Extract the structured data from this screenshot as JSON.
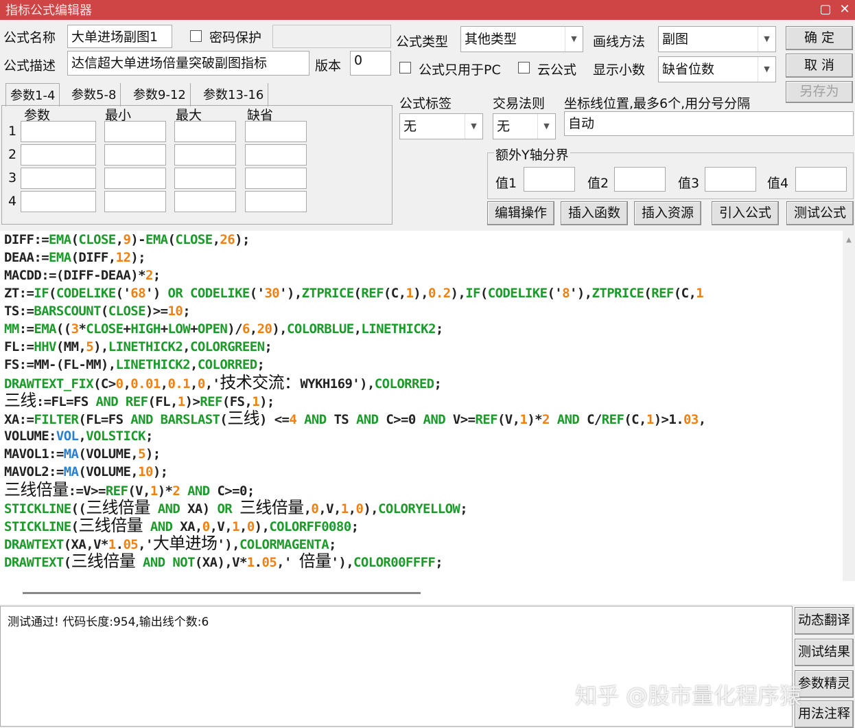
{
  "window": {
    "title": "指标公式编辑器",
    "minimize": "▢",
    "close": "✕"
  },
  "form": {
    "name_label": "公式名称",
    "name_value": "大单进场副图1",
    "password_label": "密码保护",
    "desc_label": "公式描述",
    "desc_value": "达信超大单进场倍量突破副图指标",
    "version_label": "版本",
    "version_value": "0",
    "type_label": "公式类型",
    "type_value": "其他类型",
    "draw_label": "画线方法",
    "draw_value": "副图",
    "pc_only_label": "公式只用于PC",
    "cloud_label": "云公式",
    "decimals_label": "显示小数",
    "decimals_value": "缺省位数",
    "tag_label": "公式标签",
    "tag_value": "无",
    "rule_label": "交易法则",
    "rule_value": "无",
    "axis_label": "坐标线位置,最多6个,用分号分隔",
    "axis_value": "自动",
    "extra_y_label": "额外Y轴分界",
    "v1": "值1",
    "v2": "值2",
    "v3": "值3",
    "v4": "值4"
  },
  "buttons": {
    "ok": "确 定",
    "cancel": "取 消",
    "save_as": "另存为",
    "edit": "编辑操作",
    "insert_func": "插入函数",
    "insert_res": "插入资源",
    "import": "引入公式",
    "test": "测试公式",
    "translate": "动态翻译",
    "result": "测试结果",
    "wizard": "参数精灵",
    "usage": "用法注释"
  },
  "params": {
    "tabs": [
      "参数1-4",
      "参数5-8",
      "参数9-12",
      "参数13-16"
    ],
    "headers": [
      "参数",
      "最小",
      "最大",
      "缺省"
    ],
    "rows": [
      "1",
      "2",
      "3",
      "4"
    ]
  },
  "code": [
    [
      [
        "DIFF:=",
        "k"
      ],
      [
        "EMA",
        "g"
      ],
      [
        "(",
        "k"
      ],
      [
        "CLOSE",
        "g"
      ],
      [
        ",",
        "k"
      ],
      [
        "9",
        "o"
      ],
      [
        ")-",
        "k"
      ],
      [
        "EMA",
        "g"
      ],
      [
        "(",
        "k"
      ],
      [
        "CLOSE",
        "g"
      ],
      [
        ",",
        "k"
      ],
      [
        "26",
        "o"
      ],
      [
        ");",
        "k"
      ]
    ],
    [
      [
        "DEAA:=",
        "k"
      ],
      [
        "EMA",
        "g"
      ],
      [
        "(DIFF,",
        "k"
      ],
      [
        "12",
        "o"
      ],
      [
        ");",
        "k"
      ]
    ],
    [
      [
        "MACDD:=(DIFF-DEAA)*",
        "k"
      ],
      [
        "2",
        "o"
      ],
      [
        ";",
        "k"
      ]
    ],
    [
      [
        "ZT:=",
        "k"
      ],
      [
        "IF",
        "g"
      ],
      [
        "(",
        "k"
      ],
      [
        "CODELIKE",
        "g"
      ],
      [
        "('",
        "k"
      ],
      [
        "68",
        "o"
      ],
      [
        "') ",
        "k"
      ],
      [
        "OR",
        "g"
      ],
      [
        " ",
        "k"
      ],
      [
        "CODELIKE",
        "g"
      ],
      [
        "('",
        "k"
      ],
      [
        "30",
        "o"
      ],
      [
        "'),",
        "k"
      ],
      [
        "ZTPRICE",
        "g"
      ],
      [
        "(",
        "k"
      ],
      [
        "REF",
        "g"
      ],
      [
        "(C,",
        "k"
      ],
      [
        "1",
        "o"
      ],
      [
        "),",
        "k"
      ],
      [
        "0.2",
        "o"
      ],
      [
        "),",
        "k"
      ],
      [
        "IF",
        "g"
      ],
      [
        "(",
        "k"
      ],
      [
        "CODELIKE",
        "g"
      ],
      [
        "('",
        "k"
      ],
      [
        "8",
        "o"
      ],
      [
        "'),",
        "k"
      ],
      [
        "ZTPRICE",
        "g"
      ],
      [
        "(",
        "k"
      ],
      [
        "REF",
        "g"
      ],
      [
        "(C,",
        "k"
      ],
      [
        "1",
        "o"
      ]
    ],
    [
      [
        "TS:=",
        "k"
      ],
      [
        "BARSCOUNT",
        "g"
      ],
      [
        "(",
        "k"
      ],
      [
        "CLOSE",
        "g"
      ],
      [
        ")>=",
        "k"
      ],
      [
        "10",
        "o"
      ],
      [
        ";",
        "k"
      ]
    ],
    [
      [
        "MM",
        "g"
      ],
      [
        ":=",
        "k"
      ],
      [
        "EMA",
        "g"
      ],
      [
        "((",
        "k"
      ],
      [
        "3",
        "o"
      ],
      [
        "*",
        "k"
      ],
      [
        "CLOSE",
        "g"
      ],
      [
        "+",
        "k"
      ],
      [
        "HIGH",
        "g"
      ],
      [
        "+",
        "k"
      ],
      [
        "LOW",
        "g"
      ],
      [
        "+",
        "k"
      ],
      [
        "OPEN",
        "g"
      ],
      [
        ")/",
        "k"
      ],
      [
        "6",
        "o"
      ],
      [
        ",",
        "k"
      ],
      [
        "20",
        "o"
      ],
      [
        "),",
        "k"
      ],
      [
        "COLORBLUE",
        "g"
      ],
      [
        ",",
        "k"
      ],
      [
        "LINETHICK2",
        "g"
      ],
      [
        ";",
        "k"
      ]
    ],
    [
      [
        "FL:=",
        "k"
      ],
      [
        "HHV",
        "g"
      ],
      [
        "(MM,",
        "k"
      ],
      [
        "5",
        "o"
      ],
      [
        "),",
        "k"
      ],
      [
        "LINETHICK2",
        "g"
      ],
      [
        ",",
        "k"
      ],
      [
        "COLORGREEN",
        "g"
      ],
      [
        ";",
        "k"
      ]
    ],
    [
      [
        "FS:=MM-(FL-MM),",
        "k"
      ],
      [
        "LINETHICK2",
        "g"
      ],
      [
        ",",
        "k"
      ],
      [
        "COLORRED",
        "g"
      ],
      [
        ";",
        "k"
      ]
    ],
    [
      [
        "DRAWTEXT_FIX",
        "g"
      ],
      [
        "(C>",
        "k"
      ],
      [
        "0",
        "o"
      ],
      [
        ",",
        "k"
      ],
      [
        "0.01",
        "o"
      ],
      [
        ",",
        "k"
      ],
      [
        "0.1",
        "o"
      ],
      [
        ",",
        "k"
      ],
      [
        "0",
        "o"
      ],
      [
        ",'",
        "k"
      ],
      [
        "技术交流：",
        "cn"
      ],
      [
        "WYKH169'),",
        "k"
      ],
      [
        "COLORRED",
        "g"
      ],
      [
        ";",
        "k"
      ]
    ],
    [
      [
        "三线",
        "cn"
      ],
      [
        ":=FL=FS ",
        "k"
      ],
      [
        "AND",
        "g"
      ],
      [
        " ",
        "k"
      ],
      [
        "REF",
        "g"
      ],
      [
        "(FL,",
        "k"
      ],
      [
        "1",
        "o"
      ],
      [
        ")>",
        "k"
      ],
      [
        "REF",
        "g"
      ],
      [
        "(FS,",
        "k"
      ],
      [
        "1",
        "o"
      ],
      [
        ");",
        "k"
      ]
    ],
    [
      [
        "XA:=",
        "k"
      ],
      [
        "FILTER",
        "g"
      ],
      [
        "(FL=FS ",
        "k"
      ],
      [
        "AND",
        "g"
      ],
      [
        " ",
        "k"
      ],
      [
        "BARSLAST",
        "g"
      ],
      [
        "(",
        "k"
      ],
      [
        "三线",
        "cn"
      ],
      [
        ") <=",
        "k"
      ],
      [
        "4",
        "o"
      ],
      [
        " ",
        "k"
      ],
      [
        "AND",
        "g"
      ],
      [
        " TS ",
        "k"
      ],
      [
        "AND",
        "g"
      ],
      [
        " C>=0 ",
        "k"
      ],
      [
        "AND",
        "g"
      ],
      [
        " V>=",
        "k"
      ],
      [
        "REF",
        "g"
      ],
      [
        "(V,",
        "k"
      ],
      [
        "1",
        "o"
      ],
      [
        ")*",
        "k"
      ],
      [
        "2",
        "o"
      ],
      [
        " ",
        "k"
      ],
      [
        "AND",
        "g"
      ],
      [
        " C/",
        "k"
      ],
      [
        "REF",
        "g"
      ],
      [
        "(C,",
        "k"
      ],
      [
        "1",
        "o"
      ],
      [
        ")>1.",
        "k"
      ],
      [
        "03",
        "o"
      ],
      [
        ",",
        "k"
      ]
    ],
    [
      [
        "VOLUME:",
        "k"
      ],
      [
        "VOL",
        "b"
      ],
      [
        ",",
        "k"
      ],
      [
        "VOLSTICK",
        "g"
      ],
      [
        ";",
        "k"
      ]
    ],
    [
      [
        "MAVOL1:=",
        "k"
      ],
      [
        "MA",
        "b"
      ],
      [
        "(VOLUME,",
        "k"
      ],
      [
        "5",
        "o"
      ],
      [
        ");",
        "k"
      ]
    ],
    [
      [
        "MAVOL2:=",
        "k"
      ],
      [
        "MA",
        "b"
      ],
      [
        "(VOLUME,",
        "k"
      ],
      [
        "10",
        "o"
      ],
      [
        ");",
        "k"
      ]
    ],
    [
      [
        "三线倍量",
        "cn"
      ],
      [
        ":=V>=",
        "k"
      ],
      [
        "REF",
        "g"
      ],
      [
        "(V,",
        "k"
      ],
      [
        "1",
        "o"
      ],
      [
        ")*",
        "k"
      ],
      [
        "2",
        "o"
      ],
      [
        " ",
        "k"
      ],
      [
        "AND",
        "g"
      ],
      [
        " C>=0;",
        "k"
      ]
    ],
    [
      [
        "STICKLINE",
        "g"
      ],
      [
        "((",
        "k"
      ],
      [
        "三线倍量",
        "cn"
      ],
      [
        " ",
        "k"
      ],
      [
        "AND",
        "g"
      ],
      [
        " XA) ",
        "k"
      ],
      [
        "OR",
        "g"
      ],
      [
        " ",
        "k"
      ],
      [
        "三线倍量",
        "cn"
      ],
      [
        ",",
        "k"
      ],
      [
        "0",
        "o"
      ],
      [
        ",V,",
        "k"
      ],
      [
        "1",
        "o"
      ],
      [
        ",",
        "k"
      ],
      [
        "0",
        "o"
      ],
      [
        "),",
        "k"
      ],
      [
        "COLORYELLOW",
        "g"
      ],
      [
        ";",
        "k"
      ]
    ],
    [
      [
        "STICKLINE",
        "g"
      ],
      [
        "(",
        "k"
      ],
      [
        "三线倍量",
        "cn"
      ],
      [
        " ",
        "k"
      ],
      [
        "AND",
        "g"
      ],
      [
        " XA,",
        "k"
      ],
      [
        "0",
        "o"
      ],
      [
        ",V,",
        "k"
      ],
      [
        "1",
        "o"
      ],
      [
        ",",
        "k"
      ],
      [
        "0",
        "o"
      ],
      [
        "),",
        "k"
      ],
      [
        "COLORFF0080",
        "g"
      ],
      [
        ";",
        "k"
      ]
    ],
    [
      [
        "DRAWTEXT",
        "g"
      ],
      [
        "(XA,V*",
        "k"
      ],
      [
        "1",
        "o"
      ],
      [
        ".",
        "k"
      ],
      [
        "05",
        "o"
      ],
      [
        ",'",
        "k"
      ],
      [
        "大单进场",
        "cn"
      ],
      [
        "'),",
        "k"
      ],
      [
        "COLORMAGENTA",
        "g"
      ],
      [
        ";",
        "k"
      ]
    ],
    [
      [
        "DRAWTEXT",
        "g"
      ],
      [
        "(",
        "k"
      ],
      [
        "三线倍量",
        "cn"
      ],
      [
        " ",
        "k"
      ],
      [
        "AND",
        "g"
      ],
      [
        " ",
        "k"
      ],
      [
        "NOT",
        "g"
      ],
      [
        "(XA),V*",
        "k"
      ],
      [
        "1",
        "o"
      ],
      [
        ".",
        "k"
      ],
      [
        "05",
        "o"
      ],
      [
        ",' ",
        "k"
      ],
      [
        "倍量",
        "cn"
      ],
      [
        "'),",
        "k"
      ],
      [
        "COLOR00FFFF",
        "g"
      ],
      [
        ";",
        "k"
      ]
    ]
  ],
  "output": {
    "message": "测试通过! 代码长度:954,输出线个数:6"
  },
  "watermark": "知乎 @股市量化程序猿"
}
